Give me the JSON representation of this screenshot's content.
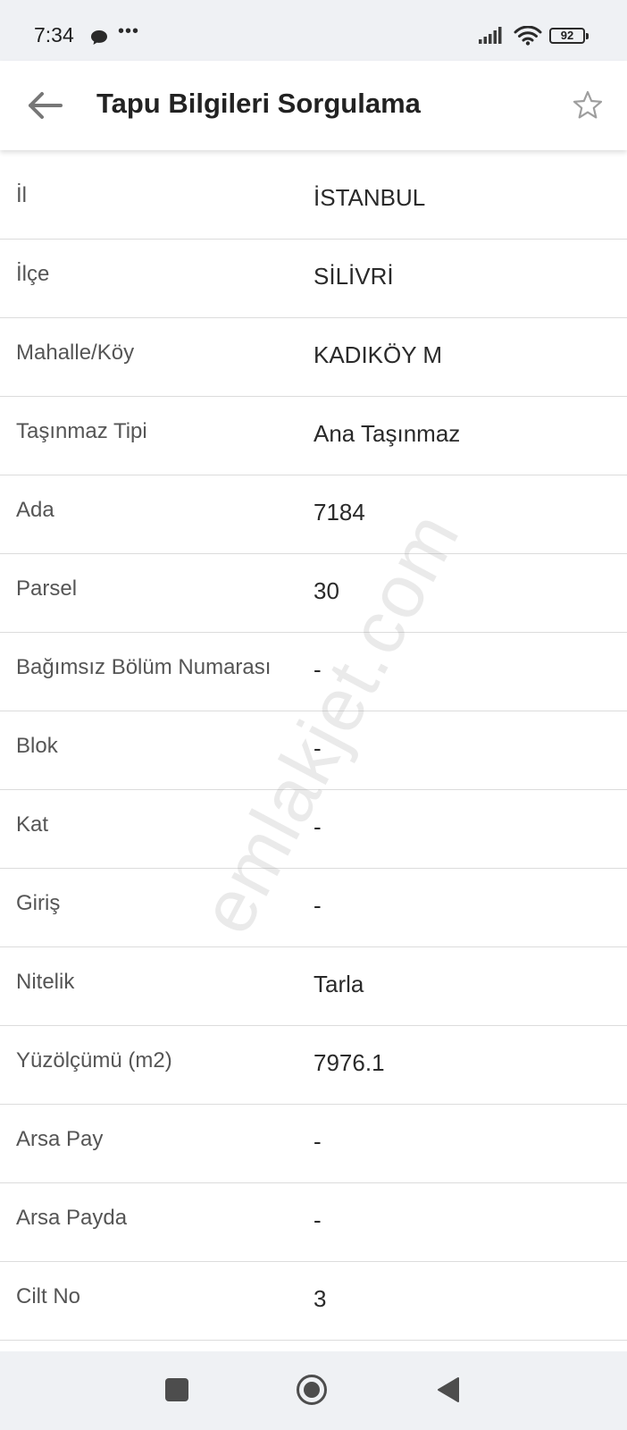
{
  "status_bar": {
    "time": "7:34",
    "more": "•••",
    "battery": "92"
  },
  "app_bar": {
    "title": "Tapu Bilgileri Sorgulama"
  },
  "rows": [
    {
      "label": "İl",
      "value": "İSTANBUL"
    },
    {
      "label": "İlçe",
      "value": "SİLİVRİ"
    },
    {
      "label": "Mahalle/Köy",
      "value": "KADIKÖY M"
    },
    {
      "label": "Taşınmaz Tipi",
      "value": "Ana Taşınmaz"
    },
    {
      "label": "Ada",
      "value": "7184"
    },
    {
      "label": "Parsel",
      "value": "30"
    },
    {
      "label": "Bağımsız Bölüm Numarası",
      "value": "-"
    },
    {
      "label": "Blok",
      "value": "-"
    },
    {
      "label": "Kat",
      "value": "-"
    },
    {
      "label": "Giriş",
      "value": "-"
    },
    {
      "label": "Nitelik",
      "value": "Tarla"
    },
    {
      "label": "Yüzölçümü (m2)",
      "value": "7976.1"
    },
    {
      "label": "Arsa Pay",
      "value": "-"
    },
    {
      "label": "Arsa Payda",
      "value": "-"
    },
    {
      "label": "Cilt No",
      "value": "3"
    }
  ],
  "watermark": "emlakjet.com",
  "colors": {
    "status_bar_bg": "#eff1f4",
    "divider": "#dcdcdc",
    "label_text": "#555555",
    "value_text": "#2a2a2a",
    "icon_gray": "#9e9e9e"
  }
}
